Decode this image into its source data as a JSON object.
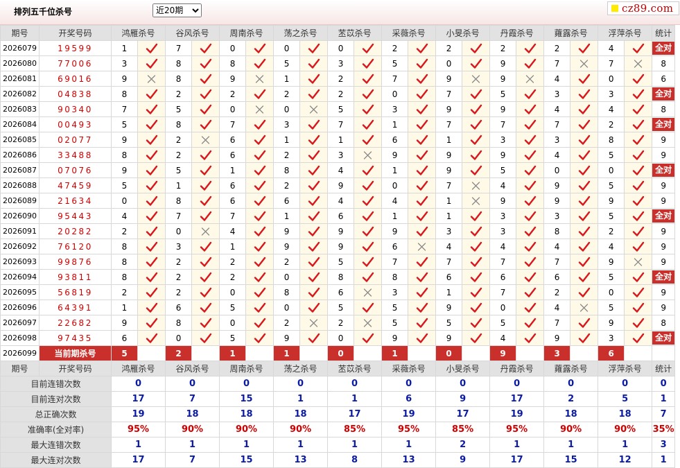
{
  "page": {
    "title": "排列五千位杀号",
    "select_value": "近20期",
    "logo_text": "cz89.com"
  },
  "header": {
    "issue": "期号",
    "winning": "开奖号码",
    "stat": "统计",
    "experts": [
      "鸿雁杀号",
      "谷风杀号",
      "周南杀号",
      "荡之杀号",
      "苤苡杀号",
      "采薇杀号",
      "小旻杀号",
      "丹霞杀号",
      "蕹露杀号",
      "浮萍杀号"
    ]
  },
  "rows": [
    {
      "issue": "2026079",
      "winning": "19599",
      "kills": [
        [
          1,
          1
        ],
        [
          7,
          1
        ],
        [
          0,
          1
        ],
        [
          0,
          1
        ],
        [
          0,
          1
        ],
        [
          2,
          1
        ],
        [
          2,
          1
        ],
        [
          2,
          1
        ],
        [
          2,
          1
        ],
        [
          4,
          1
        ]
      ],
      "stat": "全对"
    },
    {
      "issue": "2026080",
      "winning": "77006",
      "kills": [
        [
          3,
          1
        ],
        [
          8,
          1
        ],
        [
          8,
          1
        ],
        [
          5,
          1
        ],
        [
          3,
          1
        ],
        [
          5,
          1
        ],
        [
          0,
          1
        ],
        [
          9,
          1
        ],
        [
          7,
          0
        ],
        [
          7,
          0
        ]
      ],
      "stat": "8"
    },
    {
      "issue": "2026081",
      "winning": "69016",
      "kills": [
        [
          9,
          0
        ],
        [
          8,
          1
        ],
        [
          9,
          0
        ],
        [
          1,
          1
        ],
        [
          2,
          1
        ],
        [
          7,
          1
        ],
        [
          9,
          0
        ],
        [
          9,
          0
        ],
        [
          4,
          1
        ],
        [
          0,
          1
        ]
      ],
      "stat": "6"
    },
    {
      "issue": "2026082",
      "winning": "04838",
      "kills": [
        [
          8,
          1
        ],
        [
          2,
          1
        ],
        [
          2,
          1
        ],
        [
          2,
          1
        ],
        [
          2,
          1
        ],
        [
          0,
          1
        ],
        [
          7,
          1
        ],
        [
          5,
          1
        ],
        [
          3,
          1
        ],
        [
          3,
          1
        ]
      ],
      "stat": "全对"
    },
    {
      "issue": "2026083",
      "winning": "90340",
      "kills": [
        [
          7,
          1
        ],
        [
          5,
          1
        ],
        [
          0,
          0
        ],
        [
          0,
          0
        ],
        [
          5,
          1
        ],
        [
          3,
          1
        ],
        [
          9,
          1
        ],
        [
          9,
          1
        ],
        [
          4,
          1
        ],
        [
          4,
          1
        ]
      ],
      "stat": "8"
    },
    {
      "issue": "2026084",
      "winning": "00493",
      "kills": [
        [
          5,
          1
        ],
        [
          8,
          1
        ],
        [
          7,
          1
        ],
        [
          3,
          1
        ],
        [
          7,
          1
        ],
        [
          1,
          1
        ],
        [
          7,
          1
        ],
        [
          7,
          1
        ],
        [
          7,
          1
        ],
        [
          2,
          1
        ]
      ],
      "stat": "全对"
    },
    {
      "issue": "2026085",
      "winning": "02077",
      "kills": [
        [
          9,
          1
        ],
        [
          2,
          0
        ],
        [
          6,
          1
        ],
        [
          1,
          1
        ],
        [
          1,
          1
        ],
        [
          6,
          1
        ],
        [
          1,
          1
        ],
        [
          3,
          1
        ],
        [
          3,
          1
        ],
        [
          8,
          1
        ]
      ],
      "stat": "9"
    },
    {
      "issue": "2026086",
      "winning": "33488",
      "kills": [
        [
          8,
          1
        ],
        [
          2,
          1
        ],
        [
          6,
          1
        ],
        [
          2,
          1
        ],
        [
          3,
          0
        ],
        [
          9,
          1
        ],
        [
          9,
          1
        ],
        [
          9,
          1
        ],
        [
          4,
          1
        ],
        [
          5,
          1
        ]
      ],
      "stat": "9"
    },
    {
      "issue": "2026087",
      "winning": "07076",
      "kills": [
        [
          9,
          1
        ],
        [
          5,
          1
        ],
        [
          1,
          1
        ],
        [
          8,
          1
        ],
        [
          4,
          1
        ],
        [
          1,
          1
        ],
        [
          9,
          1
        ],
        [
          5,
          1
        ],
        [
          0,
          1
        ],
        [
          0,
          1
        ]
      ],
      "stat": "全对"
    },
    {
      "issue": "2026088",
      "winning": "47459",
      "kills": [
        [
          5,
          1
        ],
        [
          1,
          1
        ],
        [
          6,
          1
        ],
        [
          2,
          1
        ],
        [
          9,
          1
        ],
        [
          0,
          1
        ],
        [
          7,
          0
        ],
        [
          4,
          1
        ],
        [
          9,
          1
        ],
        [
          5,
          1
        ]
      ],
      "stat": "9"
    },
    {
      "issue": "2026089",
      "winning": "21634",
      "kills": [
        [
          0,
          1
        ],
        [
          8,
          1
        ],
        [
          6,
          1
        ],
        [
          6,
          1
        ],
        [
          4,
          1
        ],
        [
          4,
          1
        ],
        [
          1,
          0
        ],
        [
          9,
          1
        ],
        [
          9,
          1
        ],
        [
          9,
          1
        ]
      ],
      "stat": "9"
    },
    {
      "issue": "2026090",
      "winning": "95443",
      "kills": [
        [
          4,
          1
        ],
        [
          7,
          1
        ],
        [
          7,
          1
        ],
        [
          1,
          1
        ],
        [
          6,
          1
        ],
        [
          1,
          1
        ],
        [
          1,
          1
        ],
        [
          3,
          1
        ],
        [
          3,
          1
        ],
        [
          5,
          1
        ]
      ],
      "stat": "全对"
    },
    {
      "issue": "2026091",
      "winning": "20282",
      "kills": [
        [
          2,
          1
        ],
        [
          0,
          0
        ],
        [
          4,
          1
        ],
        [
          9,
          1
        ],
        [
          9,
          1
        ],
        [
          9,
          1
        ],
        [
          3,
          1
        ],
        [
          3,
          1
        ],
        [
          8,
          1
        ],
        [
          2,
          1
        ]
      ],
      "stat": "9"
    },
    {
      "issue": "2026092",
      "winning": "76120",
      "kills": [
        [
          8,
          1
        ],
        [
          3,
          1
        ],
        [
          1,
          1
        ],
        [
          9,
          1
        ],
        [
          9,
          1
        ],
        [
          6,
          0
        ],
        [
          4,
          1
        ],
        [
          4,
          1
        ],
        [
          4,
          1
        ],
        [
          4,
          1
        ]
      ],
      "stat": "9"
    },
    {
      "issue": "2026093",
      "winning": "99876",
      "kills": [
        [
          8,
          1
        ],
        [
          2,
          1
        ],
        [
          2,
          1
        ],
        [
          2,
          1
        ],
        [
          5,
          1
        ],
        [
          7,
          1
        ],
        [
          7,
          1
        ],
        [
          7,
          1
        ],
        [
          7,
          1
        ],
        [
          9,
          0
        ]
      ],
      "stat": "9"
    },
    {
      "issue": "2026094",
      "winning": "93811",
      "kills": [
        [
          8,
          1
        ],
        [
          2,
          1
        ],
        [
          2,
          1
        ],
        [
          0,
          1
        ],
        [
          8,
          1
        ],
        [
          8,
          1
        ],
        [
          6,
          1
        ],
        [
          6,
          1
        ],
        [
          6,
          1
        ],
        [
          5,
          1
        ]
      ],
      "stat": "全对"
    },
    {
      "issue": "2026095",
      "winning": "56819",
      "kills": [
        [
          2,
          1
        ],
        [
          2,
          1
        ],
        [
          0,
          1
        ],
        [
          8,
          1
        ],
        [
          6,
          0
        ],
        [
          3,
          1
        ],
        [
          1,
          1
        ],
        [
          7,
          1
        ],
        [
          2,
          1
        ],
        [
          0,
          1
        ]
      ],
      "stat": "9"
    },
    {
      "issue": "2026096",
      "winning": "64391",
      "kills": [
        [
          1,
          1
        ],
        [
          6,
          1
        ],
        [
          5,
          1
        ],
        [
          0,
          1
        ],
        [
          5,
          1
        ],
        [
          5,
          1
        ],
        [
          9,
          1
        ],
        [
          0,
          1
        ],
        [
          4,
          0
        ],
        [
          5,
          1
        ]
      ],
      "stat": "9"
    },
    {
      "issue": "2026097",
      "winning": "22682",
      "kills": [
        [
          9,
          1
        ],
        [
          8,
          1
        ],
        [
          0,
          1
        ],
        [
          2,
          0
        ],
        [
          2,
          0
        ],
        [
          5,
          1
        ],
        [
          5,
          1
        ],
        [
          5,
          1
        ],
        [
          7,
          1
        ],
        [
          9,
          1
        ]
      ],
      "stat": "8"
    },
    {
      "issue": "2026098",
      "winning": "97435",
      "kills": [
        [
          6,
          1
        ],
        [
          0,
          1
        ],
        [
          5,
          1
        ],
        [
          9,
          1
        ],
        [
          0,
          1
        ],
        [
          9,
          1
        ],
        [
          9,
          1
        ],
        [
          4,
          1
        ],
        [
          9,
          1
        ],
        [
          3,
          1
        ]
      ],
      "stat": "全对"
    }
  ],
  "current": {
    "issue": "2026099",
    "label": "当前期杀号",
    "kills": [
      "5",
      "2",
      "1",
      "1",
      "0",
      "1",
      "0",
      "9",
      "3",
      "6"
    ]
  },
  "summary": [
    {
      "label": "目前连错次数",
      "style": "blue",
      "values": [
        "0",
        "0",
        "0",
        "0",
        "0",
        "0",
        "0",
        "0",
        "0",
        "0"
      ],
      "stat": "0"
    },
    {
      "label": "目前连对次数",
      "style": "blue",
      "values": [
        "17",
        "7",
        "15",
        "1",
        "1",
        "6",
        "9",
        "17",
        "2",
        "5"
      ],
      "stat": "1"
    },
    {
      "label": "总正确次数",
      "style": "blue",
      "values": [
        "19",
        "18",
        "18",
        "18",
        "17",
        "19",
        "17",
        "19",
        "18",
        "18"
      ],
      "stat": "7"
    },
    {
      "label": "准确率(全对率)",
      "style": "red",
      "values": [
        "95%",
        "90%",
        "90%",
        "90%",
        "85%",
        "95%",
        "85%",
        "95%",
        "90%",
        "90%"
      ],
      "stat": "35%"
    },
    {
      "label": "最大连错次数",
      "style": "blue",
      "values": [
        "1",
        "1",
        "1",
        "1",
        "1",
        "1",
        "2",
        "1",
        "1",
        "1"
      ],
      "stat": "3"
    },
    {
      "label": "最大连对次数",
      "style": "blue",
      "values": [
        "17",
        "7",
        "15",
        "13",
        "8",
        "13",
        "9",
        "17",
        "15",
        "12"
      ],
      "stat": "1"
    }
  ],
  "colors": {
    "check": "#d9161b",
    "cross": "#8a8a8a",
    "highlight": "#c9302c",
    "blue": "#0a1aa8"
  },
  "icons": {
    "correct": "check-icon",
    "wrong": "cross-icon"
  }
}
